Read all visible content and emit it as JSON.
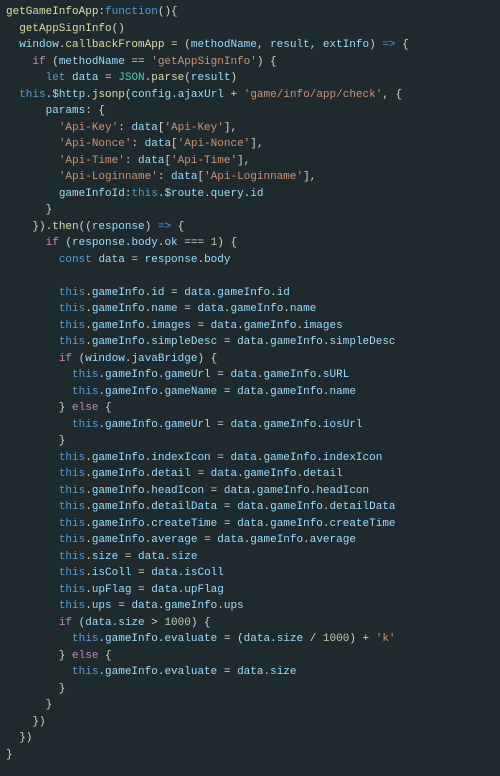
{
  "lines": [
    [
      [
        "k-yellow",
        "getGameInfoApp"
      ],
      [
        "k-white",
        ":"
      ],
      [
        "k-blue",
        "function"
      ],
      [
        "k-white",
        "(){"
      ]
    ],
    [
      [
        "k-white",
        "  "
      ],
      [
        "k-yellow",
        "getAppSignInfo"
      ],
      [
        "k-white",
        "()"
      ]
    ],
    [
      [
        "k-white",
        "  "
      ],
      [
        "k-cyan",
        "window"
      ],
      [
        "k-white",
        "."
      ],
      [
        "k-yellow",
        "callbackFromApp"
      ],
      [
        "k-white",
        " = ("
      ],
      [
        "k-cyan",
        "methodName"
      ],
      [
        "k-white",
        ", "
      ],
      [
        "k-cyan",
        "result"
      ],
      [
        "k-white",
        ", "
      ],
      [
        "k-cyan",
        "extInfo"
      ],
      [
        "k-white",
        ") "
      ],
      [
        "k-blue",
        "=>"
      ],
      [
        "k-white",
        " {"
      ]
    ],
    [
      [
        "k-white",
        "    "
      ],
      [
        "k-purple",
        "if"
      ],
      [
        "k-white",
        " ("
      ],
      [
        "k-cyan",
        "methodName"
      ],
      [
        "k-white",
        " == "
      ],
      [
        "k-string",
        "'getAppSignInfo'"
      ],
      [
        "k-white",
        ") {"
      ]
    ],
    [
      [
        "k-white",
        "      "
      ],
      [
        "k-blue",
        "let"
      ],
      [
        "k-white",
        " "
      ],
      [
        "k-cyan",
        "data"
      ],
      [
        "k-white",
        " = "
      ],
      [
        "k-teal",
        "JSON"
      ],
      [
        "k-white",
        "."
      ],
      [
        "k-yellow",
        "parse"
      ],
      [
        "k-white",
        "("
      ],
      [
        "k-cyan",
        "result"
      ],
      [
        "k-white",
        ")"
      ]
    ],
    [
      [
        "k-white",
        "  "
      ],
      [
        "k-blue",
        "this"
      ],
      [
        "k-white",
        "."
      ],
      [
        "k-cyan",
        "$http"
      ],
      [
        "k-white",
        "."
      ],
      [
        "k-yellow",
        "jsonp"
      ],
      [
        "k-white",
        "("
      ],
      [
        "k-cyan",
        "config"
      ],
      [
        "k-white",
        "."
      ],
      [
        "k-cyan",
        "ajaxUrl"
      ],
      [
        "k-white",
        " + "
      ],
      [
        "k-string",
        "'game/info/app/check'"
      ],
      [
        "k-white",
        ", {"
      ]
    ],
    [
      [
        "k-white",
        "      "
      ],
      [
        "k-cyan",
        "params"
      ],
      [
        "k-white",
        ": {"
      ]
    ],
    [
      [
        "k-white",
        "        "
      ],
      [
        "k-string",
        "'Api-Key'"
      ],
      [
        "k-white",
        ": "
      ],
      [
        "k-cyan",
        "data"
      ],
      [
        "k-white",
        "["
      ],
      [
        "k-string",
        "'Api-Key'"
      ],
      [
        "k-white",
        "],"
      ]
    ],
    [
      [
        "k-white",
        "        "
      ],
      [
        "k-string",
        "'Api-Nonce'"
      ],
      [
        "k-white",
        ": "
      ],
      [
        "k-cyan",
        "data"
      ],
      [
        "k-white",
        "["
      ],
      [
        "k-string",
        "'Api-Nonce'"
      ],
      [
        "k-white",
        "],"
      ]
    ],
    [
      [
        "k-white",
        "        "
      ],
      [
        "k-string",
        "'Api-Time'"
      ],
      [
        "k-white",
        ": "
      ],
      [
        "k-cyan",
        "data"
      ],
      [
        "k-white",
        "["
      ],
      [
        "k-string",
        "'Api-Time'"
      ],
      [
        "k-white",
        "],"
      ]
    ],
    [
      [
        "k-white",
        "        "
      ],
      [
        "k-string",
        "'Api-Loginname'"
      ],
      [
        "k-white",
        ": "
      ],
      [
        "k-cyan",
        "data"
      ],
      [
        "k-white",
        "["
      ],
      [
        "k-string",
        "'Api-Loginname'"
      ],
      [
        "k-white",
        "],"
      ]
    ],
    [
      [
        "k-white",
        "        "
      ],
      [
        "k-cyan",
        "gameInfoId"
      ],
      [
        "k-white",
        ":"
      ],
      [
        "k-blue",
        "this"
      ],
      [
        "k-white",
        "."
      ],
      [
        "k-cyan",
        "$route"
      ],
      [
        "k-white",
        "."
      ],
      [
        "k-cyan",
        "query"
      ],
      [
        "k-white",
        "."
      ],
      [
        "k-cyan",
        "id"
      ]
    ],
    [
      [
        "k-white",
        "      }"
      ]
    ],
    [
      [
        "k-white",
        "    })."
      ],
      [
        "k-yellow",
        "then"
      ],
      [
        "k-white",
        "(("
      ],
      [
        "k-cyan",
        "response"
      ],
      [
        "k-white",
        ") "
      ],
      [
        "k-blue",
        "=>"
      ],
      [
        "k-white",
        " {"
      ]
    ],
    [
      [
        "k-white",
        "      "
      ],
      [
        "k-purple",
        "if"
      ],
      [
        "k-white",
        " ("
      ],
      [
        "k-cyan",
        "response"
      ],
      [
        "k-white",
        "."
      ],
      [
        "k-cyan",
        "body"
      ],
      [
        "k-white",
        "."
      ],
      [
        "k-cyan",
        "ok"
      ],
      [
        "k-white",
        " === "
      ],
      [
        "k-num",
        "1"
      ],
      [
        "k-white",
        ") {"
      ]
    ],
    [
      [
        "k-white",
        "        "
      ],
      [
        "k-blue",
        "const"
      ],
      [
        "k-white",
        " "
      ],
      [
        "k-cyan",
        "data"
      ],
      [
        "k-white",
        " = "
      ],
      [
        "k-cyan",
        "response"
      ],
      [
        "k-white",
        "."
      ],
      [
        "k-cyan",
        "body"
      ]
    ],
    [
      [
        "k-white",
        " "
      ]
    ],
    [
      [
        "k-white",
        "        "
      ],
      [
        "k-blue",
        "this"
      ],
      [
        "k-white",
        "."
      ],
      [
        "k-cyan",
        "gameInfo"
      ],
      [
        "k-white",
        "."
      ],
      [
        "k-cyan",
        "id"
      ],
      [
        "k-white",
        " = "
      ],
      [
        "k-cyan",
        "data"
      ],
      [
        "k-white",
        "."
      ],
      [
        "k-cyan",
        "gameInfo"
      ],
      [
        "k-white",
        "."
      ],
      [
        "k-cyan",
        "id"
      ]
    ],
    [
      [
        "k-white",
        "        "
      ],
      [
        "k-blue",
        "this"
      ],
      [
        "k-white",
        "."
      ],
      [
        "k-cyan",
        "gameInfo"
      ],
      [
        "k-white",
        "."
      ],
      [
        "k-cyan",
        "name"
      ],
      [
        "k-white",
        " = "
      ],
      [
        "k-cyan",
        "data"
      ],
      [
        "k-white",
        "."
      ],
      [
        "k-cyan",
        "gameInfo"
      ],
      [
        "k-white",
        "."
      ],
      [
        "k-cyan",
        "name"
      ]
    ],
    [
      [
        "k-white",
        "        "
      ],
      [
        "k-blue",
        "this"
      ],
      [
        "k-white",
        "."
      ],
      [
        "k-cyan",
        "gameInfo"
      ],
      [
        "k-white",
        "."
      ],
      [
        "k-cyan",
        "images"
      ],
      [
        "k-white",
        " = "
      ],
      [
        "k-cyan",
        "data"
      ],
      [
        "k-white",
        "."
      ],
      [
        "k-cyan",
        "gameInfo"
      ],
      [
        "k-white",
        "."
      ],
      [
        "k-cyan",
        "images"
      ]
    ],
    [
      [
        "k-white",
        "        "
      ],
      [
        "k-blue",
        "this"
      ],
      [
        "k-white",
        "."
      ],
      [
        "k-cyan",
        "gameInfo"
      ],
      [
        "k-white",
        "."
      ],
      [
        "k-cyan",
        "simpleDesc"
      ],
      [
        "k-white",
        " = "
      ],
      [
        "k-cyan",
        "data"
      ],
      [
        "k-white",
        "."
      ],
      [
        "k-cyan",
        "gameInfo"
      ],
      [
        "k-white",
        "."
      ],
      [
        "k-cyan",
        "simpleDesc"
      ]
    ],
    [
      [
        "k-white",
        "        "
      ],
      [
        "k-purple",
        "if"
      ],
      [
        "k-white",
        " ("
      ],
      [
        "k-cyan",
        "window"
      ],
      [
        "k-white",
        "."
      ],
      [
        "k-cyan",
        "javaBridge"
      ],
      [
        "k-white",
        ") {"
      ]
    ],
    [
      [
        "k-white",
        "          "
      ],
      [
        "k-blue",
        "this"
      ],
      [
        "k-white",
        "."
      ],
      [
        "k-cyan",
        "gameInfo"
      ],
      [
        "k-white",
        "."
      ],
      [
        "k-cyan",
        "gameUrl"
      ],
      [
        "k-white",
        " = "
      ],
      [
        "k-cyan",
        "data"
      ],
      [
        "k-white",
        "."
      ],
      [
        "k-cyan",
        "gameInfo"
      ],
      [
        "k-white",
        "."
      ],
      [
        "k-cyan",
        "sURL"
      ]
    ],
    [
      [
        "k-white",
        "          "
      ],
      [
        "k-blue",
        "this"
      ],
      [
        "k-white",
        "."
      ],
      [
        "k-cyan",
        "gameInfo"
      ],
      [
        "k-white",
        "."
      ],
      [
        "k-cyan",
        "gameName"
      ],
      [
        "k-white",
        " = "
      ],
      [
        "k-cyan",
        "data"
      ],
      [
        "k-white",
        "."
      ],
      [
        "k-cyan",
        "gameInfo"
      ],
      [
        "k-white",
        "."
      ],
      [
        "k-cyan",
        "name"
      ]
    ],
    [
      [
        "k-white",
        "        } "
      ],
      [
        "k-purple",
        "else"
      ],
      [
        "k-white",
        " {"
      ]
    ],
    [
      [
        "k-white",
        "          "
      ],
      [
        "k-blue",
        "this"
      ],
      [
        "k-white",
        "."
      ],
      [
        "k-cyan",
        "gameInfo"
      ],
      [
        "k-white",
        "."
      ],
      [
        "k-cyan",
        "gameUrl"
      ],
      [
        "k-white",
        " = "
      ],
      [
        "k-cyan",
        "data"
      ],
      [
        "k-white",
        "."
      ],
      [
        "k-cyan",
        "gameInfo"
      ],
      [
        "k-white",
        "."
      ],
      [
        "k-cyan",
        "iosUrl"
      ]
    ],
    [
      [
        "k-white",
        "        }"
      ]
    ],
    [
      [
        "k-white",
        "        "
      ],
      [
        "k-blue",
        "this"
      ],
      [
        "k-white",
        "."
      ],
      [
        "k-cyan",
        "gameInfo"
      ],
      [
        "k-white",
        "."
      ],
      [
        "k-cyan",
        "indexIcon"
      ],
      [
        "k-white",
        " = "
      ],
      [
        "k-cyan",
        "data"
      ],
      [
        "k-white",
        "."
      ],
      [
        "k-cyan",
        "gameInfo"
      ],
      [
        "k-white",
        "."
      ],
      [
        "k-cyan",
        "indexIcon"
      ]
    ],
    [
      [
        "k-white",
        "        "
      ],
      [
        "k-blue",
        "this"
      ],
      [
        "k-white",
        "."
      ],
      [
        "k-cyan",
        "gameInfo"
      ],
      [
        "k-white",
        "."
      ],
      [
        "k-cyan",
        "detail"
      ],
      [
        "k-white",
        " = "
      ],
      [
        "k-cyan",
        "data"
      ],
      [
        "k-white",
        "."
      ],
      [
        "k-cyan",
        "gameInfo"
      ],
      [
        "k-white",
        "."
      ],
      [
        "k-cyan",
        "detail"
      ]
    ],
    [
      [
        "k-white",
        "        "
      ],
      [
        "k-blue",
        "this"
      ],
      [
        "k-white",
        "."
      ],
      [
        "k-cyan",
        "gameInfo"
      ],
      [
        "k-white",
        "."
      ],
      [
        "k-cyan",
        "headIcon"
      ],
      [
        "k-white",
        " = "
      ],
      [
        "k-cyan",
        "data"
      ],
      [
        "k-white",
        "."
      ],
      [
        "k-cyan",
        "gameInfo"
      ],
      [
        "k-white",
        "."
      ],
      [
        "k-cyan",
        "headIcon"
      ]
    ],
    [
      [
        "k-white",
        "        "
      ],
      [
        "k-blue",
        "this"
      ],
      [
        "k-white",
        "."
      ],
      [
        "k-cyan",
        "gameInfo"
      ],
      [
        "k-white",
        "."
      ],
      [
        "k-cyan",
        "detailData"
      ],
      [
        "k-white",
        " = "
      ],
      [
        "k-cyan",
        "data"
      ],
      [
        "k-white",
        "."
      ],
      [
        "k-cyan",
        "gameInfo"
      ],
      [
        "k-white",
        "."
      ],
      [
        "k-cyan",
        "detailData"
      ]
    ],
    [
      [
        "k-white",
        "        "
      ],
      [
        "k-blue",
        "this"
      ],
      [
        "k-white",
        "."
      ],
      [
        "k-cyan",
        "gameInfo"
      ],
      [
        "k-white",
        "."
      ],
      [
        "k-cyan",
        "createTime"
      ],
      [
        "k-white",
        " = "
      ],
      [
        "k-cyan",
        "data"
      ],
      [
        "k-white",
        "."
      ],
      [
        "k-cyan",
        "gameInfo"
      ],
      [
        "k-white",
        "."
      ],
      [
        "k-cyan",
        "createTime"
      ]
    ],
    [
      [
        "k-white",
        "        "
      ],
      [
        "k-blue",
        "this"
      ],
      [
        "k-white",
        "."
      ],
      [
        "k-cyan",
        "gameInfo"
      ],
      [
        "k-white",
        "."
      ],
      [
        "k-cyan",
        "average"
      ],
      [
        "k-white",
        " = "
      ],
      [
        "k-cyan",
        "data"
      ],
      [
        "k-white",
        "."
      ],
      [
        "k-cyan",
        "gameInfo"
      ],
      [
        "k-white",
        "."
      ],
      [
        "k-cyan",
        "average"
      ]
    ],
    [
      [
        "k-white",
        "        "
      ],
      [
        "k-blue",
        "this"
      ],
      [
        "k-white",
        "."
      ],
      [
        "k-cyan",
        "size"
      ],
      [
        "k-white",
        " = "
      ],
      [
        "k-cyan",
        "data"
      ],
      [
        "k-white",
        "."
      ],
      [
        "k-cyan",
        "size"
      ]
    ],
    [
      [
        "k-white",
        "        "
      ],
      [
        "k-blue",
        "this"
      ],
      [
        "k-white",
        "."
      ],
      [
        "k-cyan",
        "isColl"
      ],
      [
        "k-white",
        " = "
      ],
      [
        "k-cyan",
        "data"
      ],
      [
        "k-white",
        "."
      ],
      [
        "k-cyan",
        "isColl"
      ]
    ],
    [
      [
        "k-white",
        "        "
      ],
      [
        "k-blue",
        "this"
      ],
      [
        "k-white",
        "."
      ],
      [
        "k-cyan",
        "upFlag"
      ],
      [
        "k-white",
        " = "
      ],
      [
        "k-cyan",
        "data"
      ],
      [
        "k-white",
        "."
      ],
      [
        "k-cyan",
        "upFlag"
      ]
    ],
    [
      [
        "k-white",
        "        "
      ],
      [
        "k-blue",
        "this"
      ],
      [
        "k-white",
        "."
      ],
      [
        "k-cyan",
        "ups"
      ],
      [
        "k-white",
        " = "
      ],
      [
        "k-cyan",
        "data"
      ],
      [
        "k-white",
        "."
      ],
      [
        "k-cyan",
        "gameInfo"
      ],
      [
        "k-white",
        "."
      ],
      [
        "k-cyan",
        "ups"
      ]
    ],
    [
      [
        "k-white",
        "        "
      ],
      [
        "k-purple",
        "if"
      ],
      [
        "k-white",
        " ("
      ],
      [
        "k-cyan",
        "data"
      ],
      [
        "k-white",
        "."
      ],
      [
        "k-cyan",
        "size"
      ],
      [
        "k-white",
        " > "
      ],
      [
        "k-num",
        "1000"
      ],
      [
        "k-white",
        ") {"
      ]
    ],
    [
      [
        "k-white",
        "          "
      ],
      [
        "k-blue",
        "this"
      ],
      [
        "k-white",
        "."
      ],
      [
        "k-cyan",
        "gameInfo"
      ],
      [
        "k-white",
        "."
      ],
      [
        "k-cyan",
        "evaluate"
      ],
      [
        "k-white",
        " = ("
      ],
      [
        "k-cyan",
        "data"
      ],
      [
        "k-white",
        "."
      ],
      [
        "k-cyan",
        "size"
      ],
      [
        "k-white",
        " / "
      ],
      [
        "k-num",
        "1000"
      ],
      [
        "k-white",
        ") + "
      ],
      [
        "k-string",
        "'k'"
      ]
    ],
    [
      [
        "k-white",
        "        } "
      ],
      [
        "k-purple",
        "else"
      ],
      [
        "k-white",
        " {"
      ]
    ],
    [
      [
        "k-white",
        "          "
      ],
      [
        "k-blue",
        "this"
      ],
      [
        "k-white",
        "."
      ],
      [
        "k-cyan",
        "gameInfo"
      ],
      [
        "k-white",
        "."
      ],
      [
        "k-cyan",
        "evaluate"
      ],
      [
        "k-white",
        " = "
      ],
      [
        "k-cyan",
        "data"
      ],
      [
        "k-white",
        "."
      ],
      [
        "k-cyan",
        "size"
      ]
    ],
    [
      [
        "k-white",
        "        }"
      ]
    ],
    [
      [
        "k-white",
        "      }"
      ]
    ],
    [
      [
        "k-white",
        "    })"
      ]
    ],
    [
      [
        "k-white",
        "  })"
      ]
    ],
    [
      [
        "k-white",
        "}"
      ]
    ]
  ]
}
